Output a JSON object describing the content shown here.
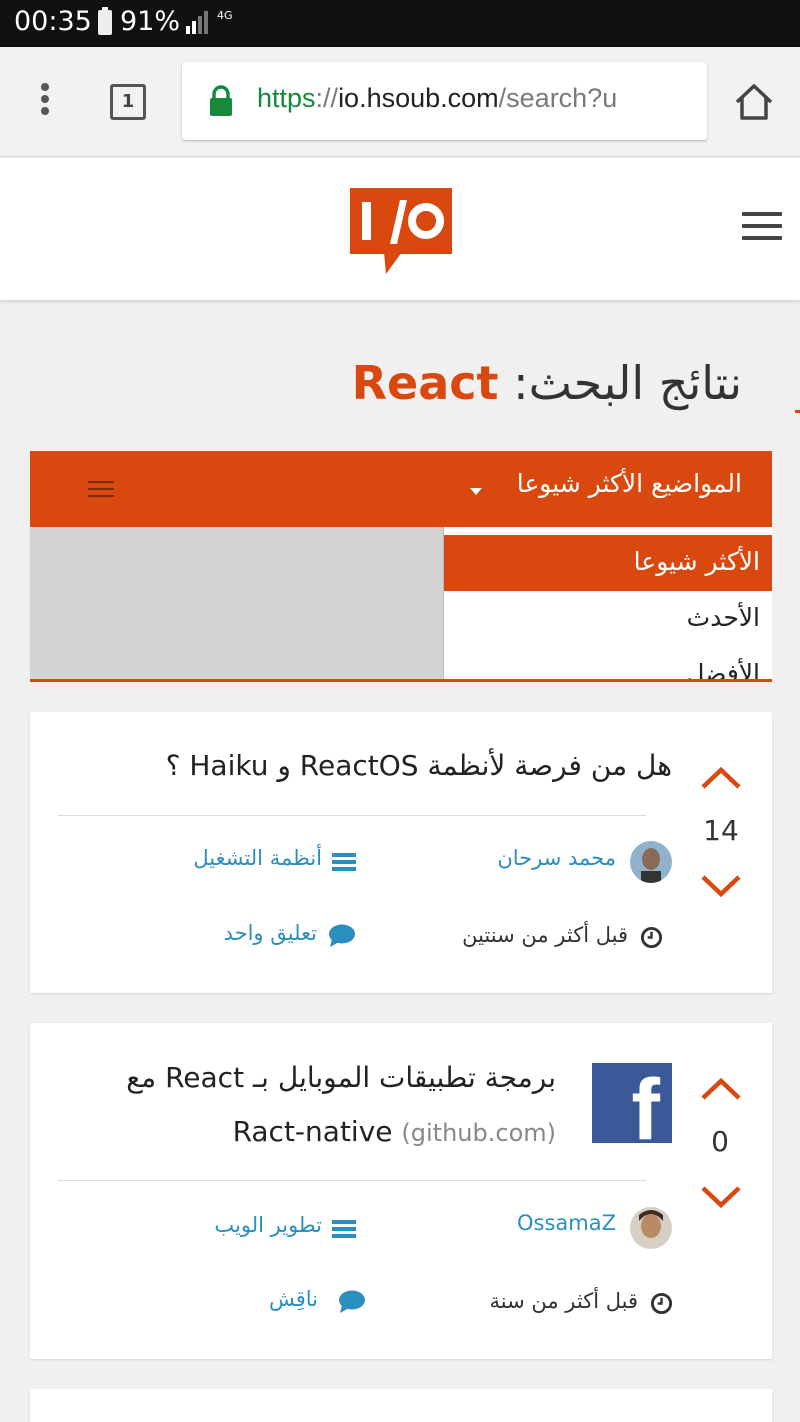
{
  "status_bar": {
    "time": "00:35",
    "battery": "91%",
    "network": "4G"
  },
  "browser": {
    "tab_count": "1",
    "url_scheme": "https",
    "url_sep": "://",
    "url_host": "io.hsoub.com",
    "url_path": "/search?u"
  },
  "page": {
    "title_prefix": "نتائج البحث:",
    "search_term": "React",
    "sort_bar_label": "المواضيع الأكثر شيوعا",
    "sort_options": [
      "الأكثر شيوعا",
      "الأحدث",
      "الأفضل"
    ],
    "selected_sort": "الأكثر شيوعا"
  },
  "posts": [
    {
      "votes": "14",
      "title": "هل من فرصة لأنظمة ReactOS و Haiku ؟",
      "author": "محمد سرحان",
      "community": "أنظمة التشغيل",
      "time": "قبل أكثر من سنتين",
      "comments": "تعليق واحد"
    },
    {
      "votes": "0",
      "title": "برمجة تطبيقات الموبايل بـ React مع Ract-native",
      "domain": "(github.com)",
      "author": "OssamaZ",
      "community": "تطوير الويب",
      "time": "قبل أكثر من سنة",
      "comments": "ناقِش"
    }
  ],
  "colors": {
    "accent": "#d9480f",
    "link": "#2a8fbf",
    "facebook": "#3b5998"
  }
}
